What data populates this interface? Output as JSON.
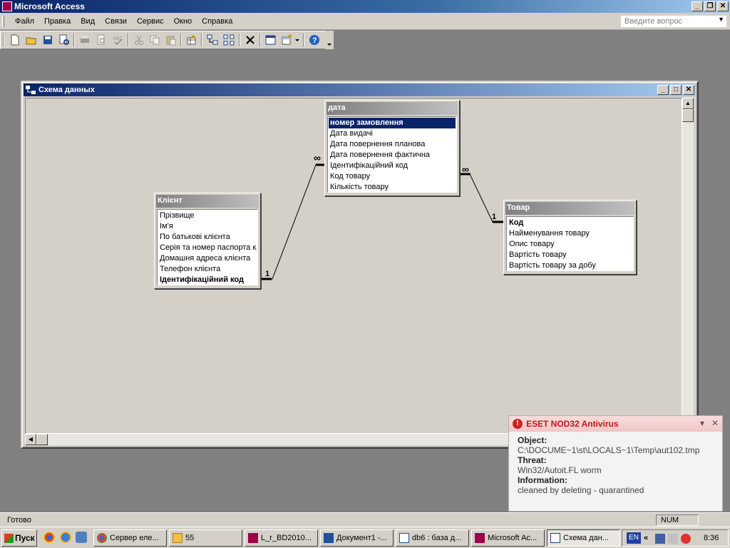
{
  "app": {
    "title": "Microsoft Access",
    "window_controls": [
      "_",
      "❐",
      "✕"
    ]
  },
  "menu": {
    "items": [
      "Файл",
      "Правка",
      "Вид",
      "Связи",
      "Сервис",
      "Окно",
      "Справка"
    ],
    "question_placeholder": "Введите вопрос"
  },
  "toolbar": {
    "icons": [
      "new-icon",
      "open-icon",
      "save-icon",
      "file-search-icon",
      "print-icon",
      "print-preview-icon",
      "spelling-icon",
      "cut-icon",
      "copy-icon",
      "paste-icon",
      "show-table-icon",
      "direct-relationships-icon",
      "all-relationships-icon",
      "delete-icon",
      "database-window-icon",
      "new-object-icon",
      "help-icon"
    ]
  },
  "schema_window": {
    "title": "Схема данных",
    "window_controls": [
      "_",
      "□",
      "✕"
    ]
  },
  "tables": [
    {
      "name": "Клієнт",
      "fields": [
        "Прізвище",
        "Ім'я",
        "По батькові клієнта",
        "Серія та номер паспорта кл",
        "Домашня адреса клієнта",
        "Телефон клієнта",
        "Ідентифікаційний код"
      ],
      "key_field": 6
    },
    {
      "name": "дата",
      "fields": [
        "номер замовлення",
        "Дата видачі",
        "Дата повернення планова",
        "Дата повернення фактична",
        "Ідентифікаційний код",
        "Код товару",
        "Кількість товару"
      ],
      "selected_field": 0
    },
    {
      "name": "Товар",
      "fields": [
        "Код",
        "Найменування товару",
        "Опис товару",
        "Вартість товару",
        "Вартість товару за добу"
      ],
      "key_field": 0
    }
  ],
  "relationships": {
    "one": "1",
    "many": "∞"
  },
  "status": {
    "text": "Готово",
    "num": "NUM"
  },
  "notification": {
    "title": "ESET NOD32 Antivirus",
    "object_label": "Object:",
    "object_value": "C:\\DOCUME~1\\st\\LOCALS~1\\Temp\\aut102.tmp",
    "threat_label": "Threat:",
    "threat_value": "Win32/Autoit.FL worm",
    "info_label": "Information:",
    "info_value": "cleaned by deleting - quarantined"
  },
  "taskbar": {
    "start": "Пуск",
    "tasks": [
      "Сервер еле...",
      "55",
      "L_r_BD2010...",
      "Документ1 -...",
      "db6 : база д...",
      "Microsoft Ac...",
      "Схема дан..."
    ],
    "active_task": 6,
    "language": "EN",
    "clock": "8:36",
    "tray_chevron": "«"
  },
  "colors": {
    "title_blue": "#0a246a",
    "face": "#d4d0c8",
    "workspace": "#808080",
    "eset_red": "#c01818"
  }
}
